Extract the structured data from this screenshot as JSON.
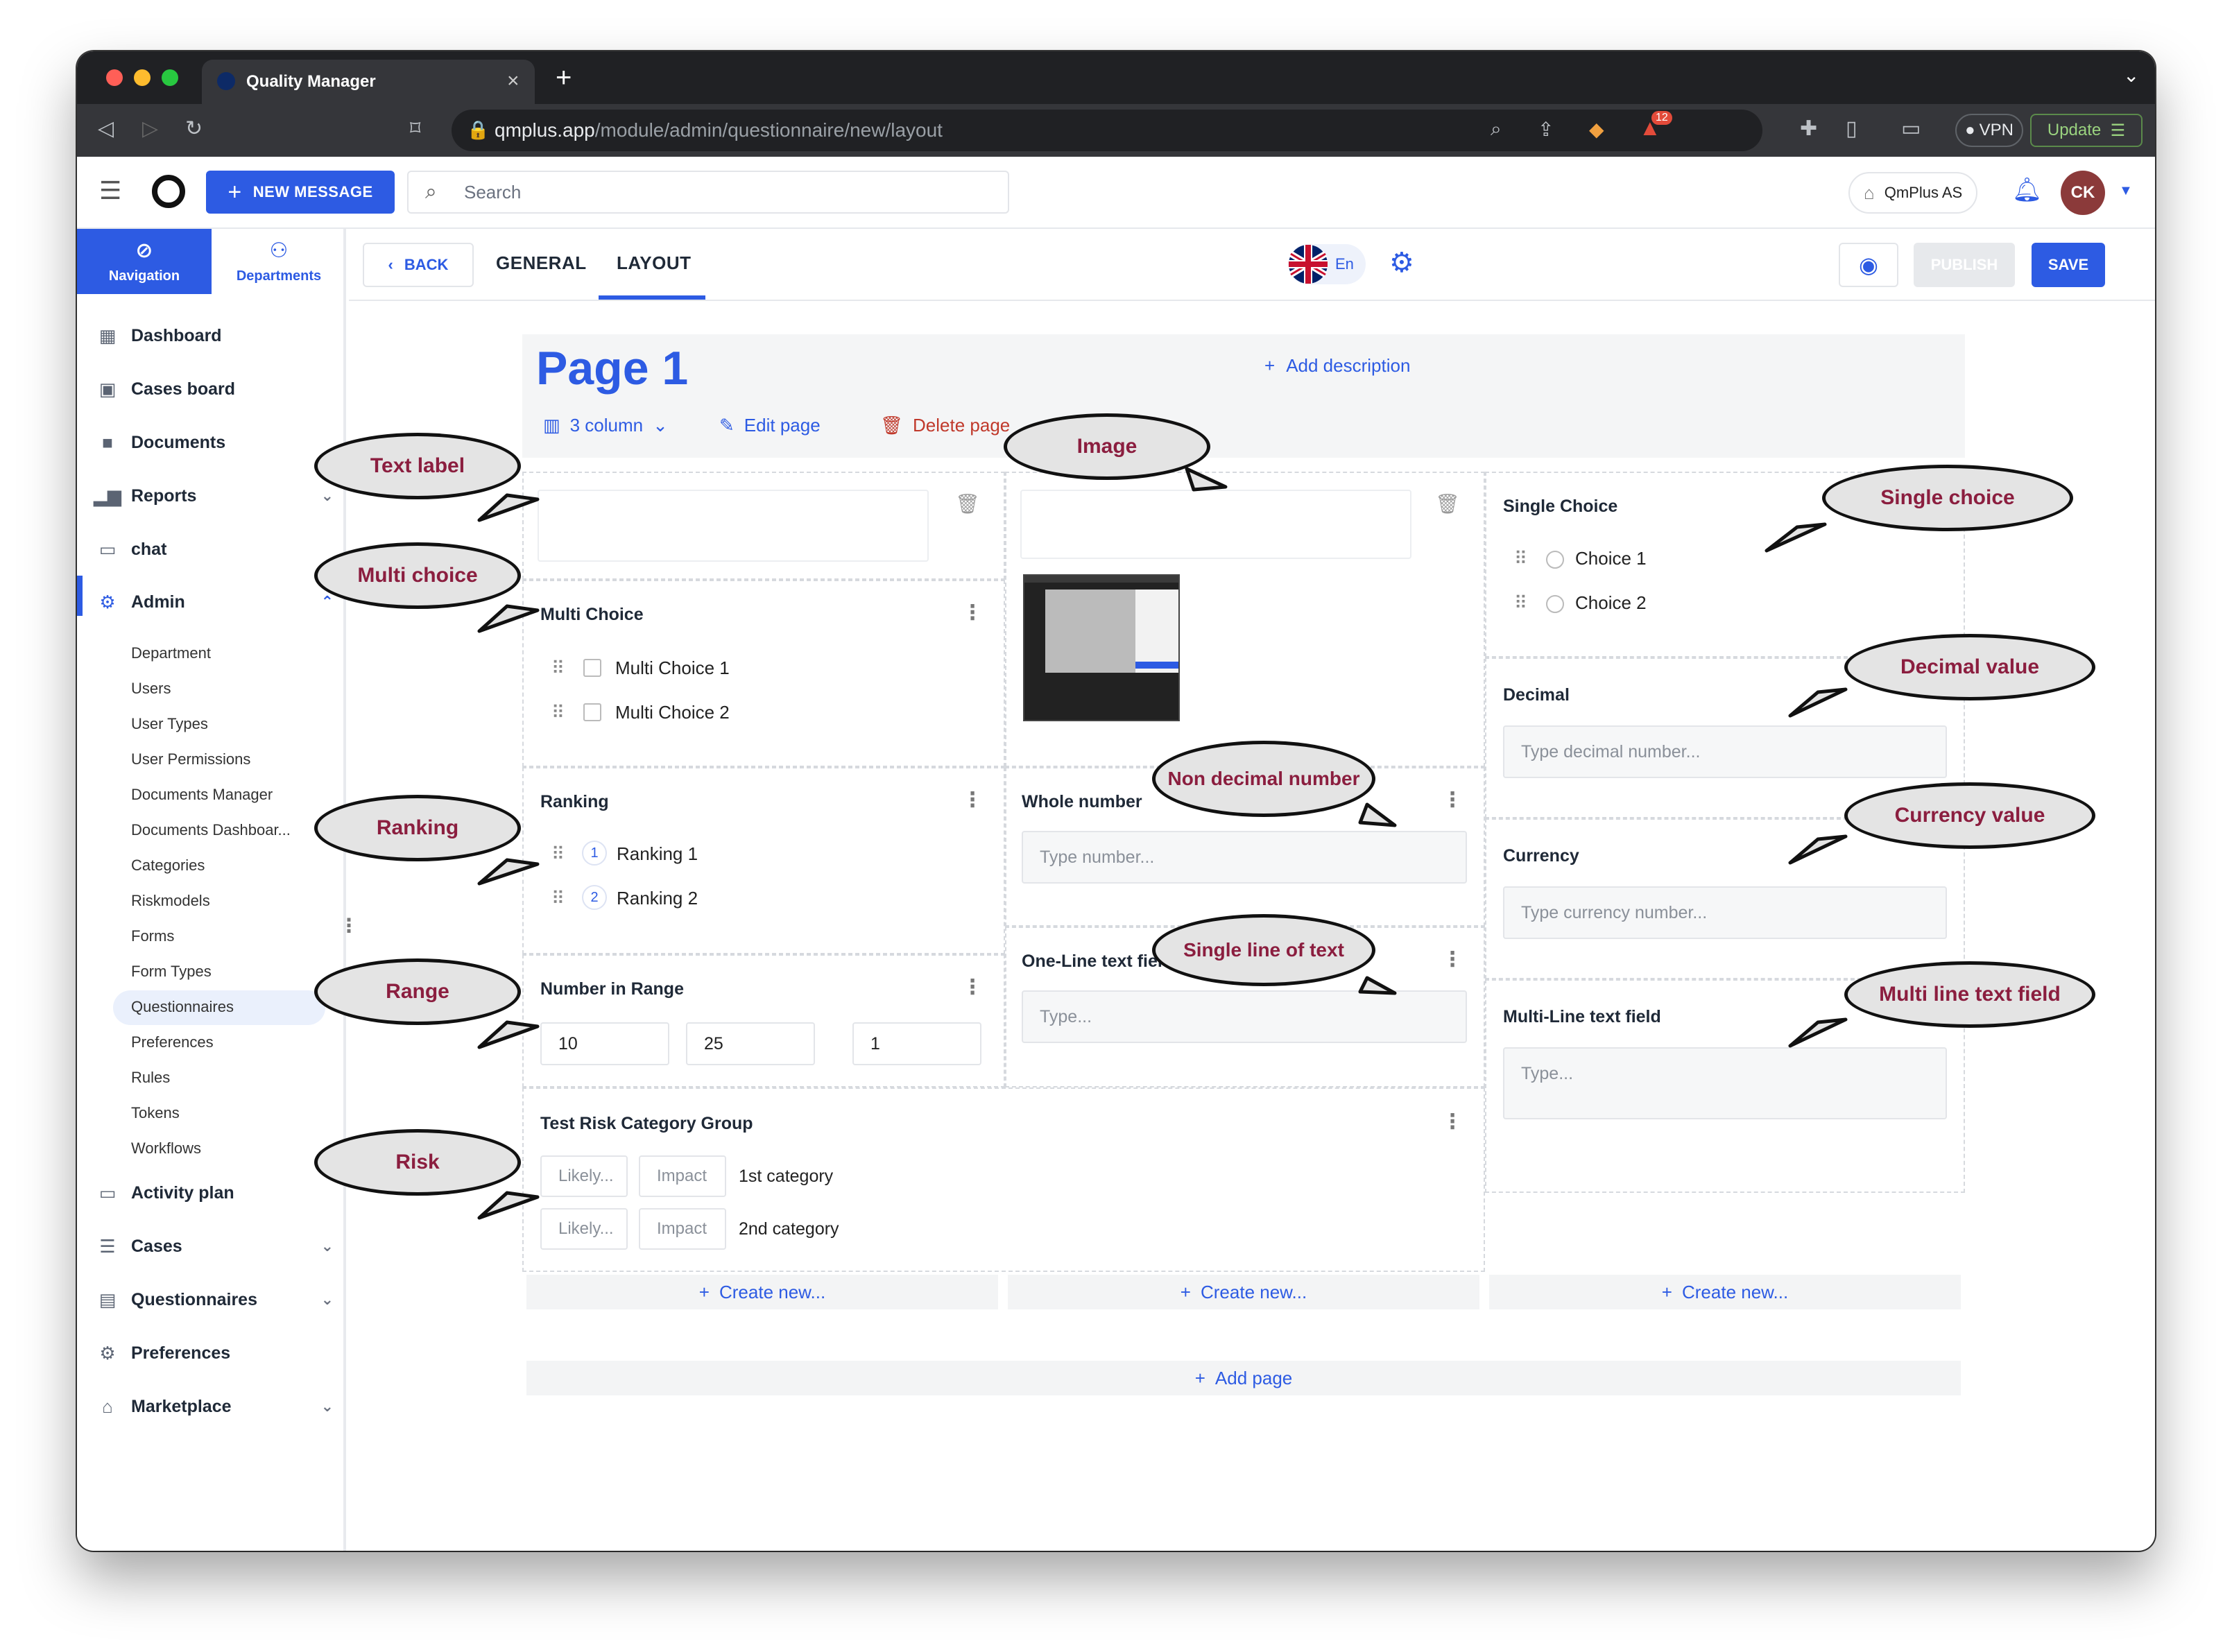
{
  "browser": {
    "tab_title": "Quality Manager",
    "url_domain": "qmplus.app",
    "url_path": "/module/admin/questionnaire/new/layout",
    "badge_count": "12",
    "vpn_label": "VPN",
    "update_label": "Update"
  },
  "header": {
    "new_message_label": "NEW MESSAGE",
    "search_placeholder": "Search",
    "company": "QmPlus AS",
    "avatar_initials": "CK"
  },
  "sidebar": {
    "tabs": [
      {
        "label": "Navigation"
      },
      {
        "label": "Departments"
      }
    ],
    "items": [
      {
        "label": "Dashboard",
        "icon": "dashboard-icon"
      },
      {
        "label": "Cases board",
        "icon": "board-icon"
      },
      {
        "label": "Documents",
        "icon": "folder-icon"
      },
      {
        "label": "Reports",
        "icon": "bar-chart-icon"
      },
      {
        "label": "chat",
        "icon": "calendar-icon"
      },
      {
        "label": "Admin",
        "icon": "gears-icon"
      }
    ],
    "admin_sub": [
      "Department",
      "Users",
      "User Types",
      "User Permissions",
      "Documents Manager",
      "Documents Dashboar...",
      "Categories",
      "Riskmodels",
      "Forms",
      "Form Types",
      "Questionnaires",
      "Preferences",
      "Rules",
      "Tokens",
      "Workflows"
    ],
    "bottom_items": [
      {
        "label": "Activity plan",
        "icon": "calendar-icon"
      },
      {
        "label": "Cases",
        "icon": "cases-icon"
      },
      {
        "label": "Questionnaires",
        "icon": "clipboard-icon"
      },
      {
        "label": "Preferences",
        "icon": "gear-icon"
      },
      {
        "label": "Marketplace",
        "icon": "store-icon"
      }
    ]
  },
  "toolbar": {
    "back_label": "BACK",
    "tab_general": "GENERAL",
    "tab_layout": "LAYOUT",
    "language": "En",
    "publish_label": "PUBLISH",
    "save_label": "SAVE"
  },
  "page": {
    "title": "Page 1",
    "add_description": "Add description",
    "columns_label": "3 column",
    "edit_page": "Edit page",
    "delete_page": "Delete page",
    "add_page": "Add page",
    "create_new": "Create new..."
  },
  "fields": {
    "multi_choice": {
      "label": "Multi Choice",
      "options": [
        "Multi Choice 1",
        "Multi Choice 2"
      ]
    },
    "ranking": {
      "label": "Ranking",
      "options": [
        {
          "num": "1",
          "text": "Ranking 1"
        },
        {
          "num": "2",
          "text": "Ranking 2"
        }
      ]
    },
    "range": {
      "label": "Number in Range",
      "values": [
        "10",
        "25",
        "1"
      ]
    },
    "risk": {
      "label": "Test Risk Category Group",
      "likely": "Likely...",
      "impact": "Impact",
      "rows": [
        "1st category",
        "2nd category"
      ]
    },
    "whole_number": {
      "label": "Whole number",
      "placeholder": "Type number..."
    },
    "one_line": {
      "label": "One-Line text field",
      "placeholder": "Type..."
    },
    "single_choice": {
      "label": "Single Choice",
      "options": [
        "Choice 1",
        "Choice 2"
      ]
    },
    "decimal": {
      "label": "Decimal",
      "placeholder": "Type decimal number..."
    },
    "currency": {
      "label": "Currency",
      "placeholder": "Type currency number..."
    },
    "multi_line": {
      "label": "Multi-Line text field",
      "placeholder": "Type..."
    }
  },
  "annotations": {
    "text_label": "Text label",
    "multi_choice": "Multi choice",
    "ranking": "Ranking",
    "range": "Range",
    "risk": "Risk",
    "image": "Image",
    "non_decimal": "Non decimal number",
    "single_line": "Single line of text",
    "single_choice": "Single choice",
    "decimal": "Decimal value",
    "currency": "Currency value",
    "multi_line": "Multi line text field"
  },
  "colors": {
    "accent": "#2d5be3",
    "danger": "#c0392b",
    "annotation_text": "#8b1e3f"
  }
}
